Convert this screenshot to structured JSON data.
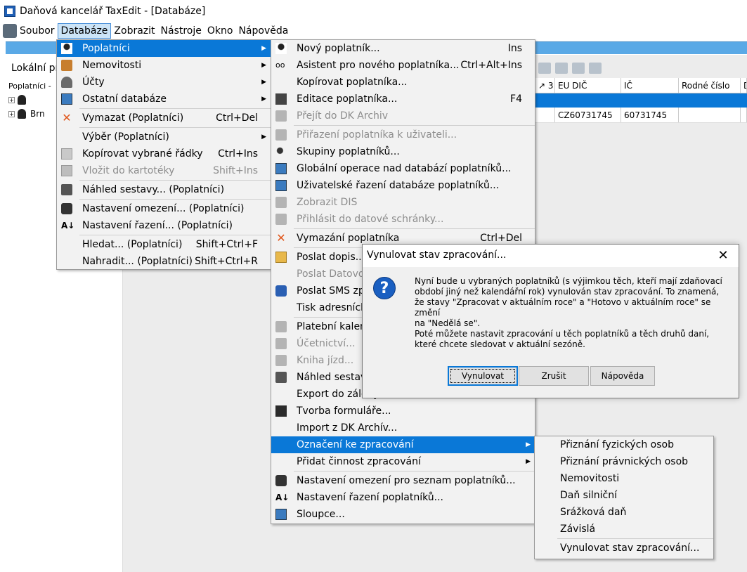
{
  "window": {
    "title": "Daňová kancelář TaxEdit - [Databáze]"
  },
  "menubar": {
    "items": [
      "Soubor",
      "Databáze",
      "Zobrazit",
      "Nástroje",
      "Okno",
      "Nápověda"
    ]
  },
  "left_panel": {
    "title": "Lokální pr",
    "header": "Poplatníci -",
    "rows": [
      "",
      "Brn"
    ]
  },
  "grid": {
    "headers": [
      "↗ 3",
      "EU DIČ",
      "IČ",
      "Rodné číslo",
      "D"
    ],
    "row": [
      "",
      "CZ60731745",
      "60731745",
      "",
      ""
    ]
  },
  "menu_databaze": {
    "items": [
      {
        "label": "Poplatníci",
        "shortcut": "",
        "submenu": true,
        "highlight": true,
        "icon": "person-icon"
      },
      {
        "label": "Nemovitosti",
        "shortcut": "",
        "submenu": true,
        "icon": "box-icon"
      },
      {
        "label": "Účty",
        "shortcut": "",
        "submenu": true,
        "icon": "bell-icon"
      },
      {
        "label": "Ostatní databáze",
        "shortcut": "",
        "submenu": true,
        "icon": "grid-icon"
      },
      {
        "label": "Vymazat (Poplatníci)",
        "shortcut": "Ctrl+Del",
        "icon": "delete-icon",
        "sep_before": true
      },
      {
        "label": "Výběr (Poplatníci)",
        "shortcut": "",
        "submenu": true,
        "icon": "none",
        "sep_before": true
      },
      {
        "label": "Kopírovat vybrané řádky",
        "shortcut": "Ctrl+Ins",
        "icon": "copy-icon"
      },
      {
        "label": "Vložit do kartotéky",
        "shortcut": "Shift+Ins",
        "icon": "paste-icon",
        "disabled": true
      },
      {
        "label": "Náhled sestavy... (Poplatníci)",
        "shortcut": "",
        "icon": "preview-icon",
        "sep_before": true
      },
      {
        "label": "Nastavení omezení... (Poplatníci)",
        "shortcut": "",
        "icon": "filter-icon",
        "sep_before": true
      },
      {
        "label": "Nastavení řazení... (Poplatníci)",
        "shortcut": "",
        "icon": "sort-icon"
      },
      {
        "label": "Hledat... (Poplatníci)",
        "shortcut": "Shift+Ctrl+F",
        "icon": "none",
        "sep_before": true
      },
      {
        "label": "Nahradit... (Poplatníci)",
        "shortcut": "Shift+Ctrl+R",
        "icon": "none"
      }
    ]
  },
  "menu_poplatnici": {
    "items": [
      {
        "label": "Nový poplatník...",
        "shortcut": "Ins",
        "icon": "person-icon"
      },
      {
        "label": "Asistent pro nového poplatníka...",
        "shortcut": "Ctrl+Alt+Ins",
        "icon": "glasses-icon"
      },
      {
        "label": "Kopírovat poplatníka...",
        "shortcut": "",
        "icon": "none"
      },
      {
        "label": "Editace poplatníka...",
        "shortcut": "F4",
        "icon": "edit-icon"
      },
      {
        "label": "Přejít do DK Archiv",
        "shortcut": "",
        "icon": "gray-icon",
        "disabled": true
      },
      {
        "label": "Přiřazení poplatníka k uživateli...",
        "shortcut": "",
        "icon": "gray-icon",
        "disabled": true,
        "sep_before": true
      },
      {
        "label": "Skupiny poplatníků...",
        "shortcut": "",
        "icon": "group-icon"
      },
      {
        "label": "Globální operace nad databází poplatníků...",
        "shortcut": "",
        "icon": "grid-icon"
      },
      {
        "label": "Uživatelské řazení databáze poplatníků...",
        "shortcut": "",
        "icon": "grid-icon"
      },
      {
        "label": "Zobrazit DIS",
        "shortcut": "",
        "icon": "gray-icon",
        "disabled": true
      },
      {
        "label": "Přihlásit do datové schránky...",
        "shortcut": "",
        "icon": "gray-icon",
        "disabled": true
      },
      {
        "label": "Vymazání poplatníka",
        "shortcut": "Ctrl+Del",
        "icon": "delete-icon",
        "sep_before": true
      },
      {
        "label": "Poslat dopis...",
        "shortcut": "",
        "icon": "letter-icon",
        "sep_before": true
      },
      {
        "label": "Poslat Datovou",
        "shortcut": "",
        "icon": "none",
        "disabled": true
      },
      {
        "label": "Poslat SMS zpr",
        "shortcut": "",
        "icon": "phone-icon"
      },
      {
        "label": "Tisk adresních",
        "shortcut": "",
        "icon": "none"
      },
      {
        "label": "Platební kalend",
        "shortcut": "",
        "icon": "gray-icon",
        "sep_before": true
      },
      {
        "label": "Účetnictví...",
        "shortcut": "",
        "icon": "gray-icon",
        "disabled": true
      },
      {
        "label": "Kniha jízd...",
        "shortcut": "",
        "icon": "gray-icon",
        "disabled": true
      },
      {
        "label": "Náhled sestavy",
        "shortcut": "",
        "icon": "preview-icon"
      },
      {
        "label": "Export do zálohy...",
        "shortcut": "",
        "icon": "none"
      },
      {
        "label": "Tvorba formuláře...",
        "shortcut": "",
        "icon": "doc-icon"
      },
      {
        "label": "Import z DK Archív...",
        "shortcut": "",
        "icon": "none"
      },
      {
        "label": "Označení ke zpracování",
        "shortcut": "",
        "submenu": true,
        "highlight": true,
        "icon": "none"
      },
      {
        "label": "Přidat činnost zpracování",
        "shortcut": "",
        "submenu": true,
        "icon": "none"
      },
      {
        "label": "Nastavení omezení pro seznam poplatníků...",
        "shortcut": "",
        "icon": "filter-icon",
        "sep_before": true
      },
      {
        "label": "Nastavení řazení poplatníků...",
        "shortcut": "",
        "icon": "sort-icon"
      },
      {
        "label": "Sloupce...",
        "shortcut": "",
        "icon": "grid-icon"
      }
    ]
  },
  "menu_oznaceni": {
    "items": [
      {
        "label": "Přiznání fyzických osob"
      },
      {
        "label": "Přiznání právnických osob"
      },
      {
        "label": "Nemovitosti"
      },
      {
        "label": "Daň silniční"
      },
      {
        "label": "Srážková daň"
      },
      {
        "label": "Závislá"
      },
      {
        "label": "Vynulovat stav  zpracování...",
        "sep_before": true
      }
    ]
  },
  "dialog": {
    "title": "Vynulovat stav zpracování...",
    "message_lines": [
      "Nyní bude u vybraných poplatníků (s výjimkou těch, kteří mají zdaňovací",
      "období jiný než kalendářní rok) vynulován stav zpracování. To znamená,",
      "že stavy \"Zpracovat v aktuálním roce\" a \"Hotovo v aktuálním roce\" se změní",
      "na \"Nedělá se\".",
      "Poté můžete nastavit zpracování u těch poplatníků a těch druhů daní,",
      "které chcete sledovat v aktuální sezóně."
    ],
    "buttons": {
      "ok": "Vynulovat",
      "cancel": "Zrušit",
      "help": "Nápověda"
    }
  }
}
